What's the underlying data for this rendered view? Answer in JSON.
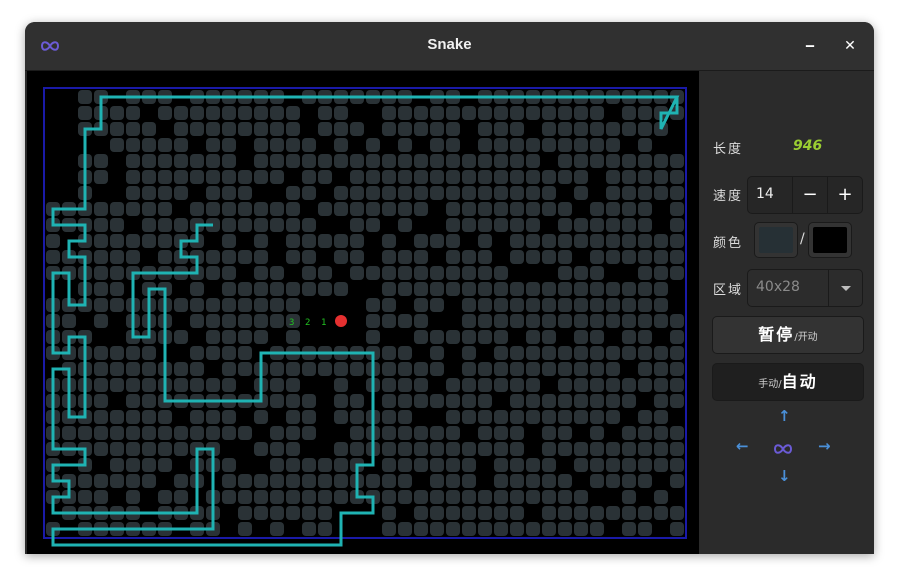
{
  "window": {
    "title": "Snake",
    "minimize_label": "‒",
    "close_label": "✕"
  },
  "panel": {
    "length_label": "长度",
    "length_value": "946",
    "speed_label": "速度",
    "speed_value": "14",
    "speed_dec": "−",
    "speed_inc": "+",
    "color_label": "颜色",
    "color_snake": "#263035",
    "color_bg": "#000000",
    "color_sep": "/",
    "area_label": "区域",
    "area_value": "40x28",
    "pause_main": "暂停",
    "pause_sep": "/",
    "pause_alt": "开动",
    "mode_alt": "手动",
    "mode_sep": "/",
    "mode_main": "自动",
    "dpad": {
      "up": "↑",
      "down": "↓",
      "left": "←",
      "right": "→",
      "center_icon": "infinity-icon"
    }
  },
  "board": {
    "cols": 40,
    "rows": 28,
    "border_color": "#1a1aa8",
    "snake_color": "#2a3236",
    "path_color": "#1fb3b3",
    "apple_color": "#e53030",
    "countdown": [
      "3",
      "2",
      "1"
    ],
    "countdown_color": "#22c322",
    "path": [
      [
        39,
        0
      ],
      [
        39,
        1
      ],
      [
        38,
        1
      ],
      [
        38,
        2
      ],
      [
        39,
        0
      ],
      [
        3,
        0
      ],
      [
        3,
        2
      ],
      [
        2,
        2
      ],
      [
        2,
        7
      ],
      [
        0,
        7
      ],
      [
        0,
        8
      ],
      [
        2,
        8
      ],
      [
        2,
        9
      ],
      [
        1,
        9
      ],
      [
        1,
        10
      ],
      [
        2,
        10
      ],
      [
        2,
        13
      ],
      [
        1,
        13
      ],
      [
        1,
        11
      ],
      [
        0,
        11
      ],
      [
        0,
        16
      ],
      [
        1,
        16
      ],
      [
        1,
        15
      ],
      [
        2,
        15
      ],
      [
        2,
        20
      ],
      [
        1,
        20
      ],
      [
        1,
        17
      ],
      [
        0,
        17
      ],
      [
        0,
        22
      ],
      [
        2,
        22
      ],
      [
        2,
        23
      ],
      [
        0,
        23
      ],
      [
        0,
        24
      ],
      [
        1,
        24
      ],
      [
        1,
        25
      ],
      [
        0,
        25
      ],
      [
        0,
        26
      ],
      [
        9,
        26
      ],
      [
        9,
        22
      ],
      [
        10,
        22
      ],
      [
        10,
        27
      ],
      [
        0,
        27
      ],
      [
        0,
        28
      ],
      [
        18,
        28
      ],
      [
        18,
        26
      ],
      [
        20,
        26
      ],
      [
        20,
        25
      ],
      [
        19,
        25
      ],
      [
        19,
        23
      ],
      [
        20,
        23
      ],
      [
        20,
        16
      ],
      [
        13,
        16
      ],
      [
        13,
        19
      ],
      [
        7,
        19
      ],
      [
        7,
        12
      ],
      [
        6,
        12
      ],
      [
        6,
        15
      ],
      [
        5,
        15
      ],
      [
        5,
        11
      ],
      [
        9,
        11
      ],
      [
        9,
        10
      ],
      [
        8,
        10
      ],
      [
        8,
        9
      ],
      [
        9,
        9
      ],
      [
        9,
        8
      ],
      [
        10,
        8
      ]
    ],
    "apple": [
      18,
      14
    ]
  }
}
